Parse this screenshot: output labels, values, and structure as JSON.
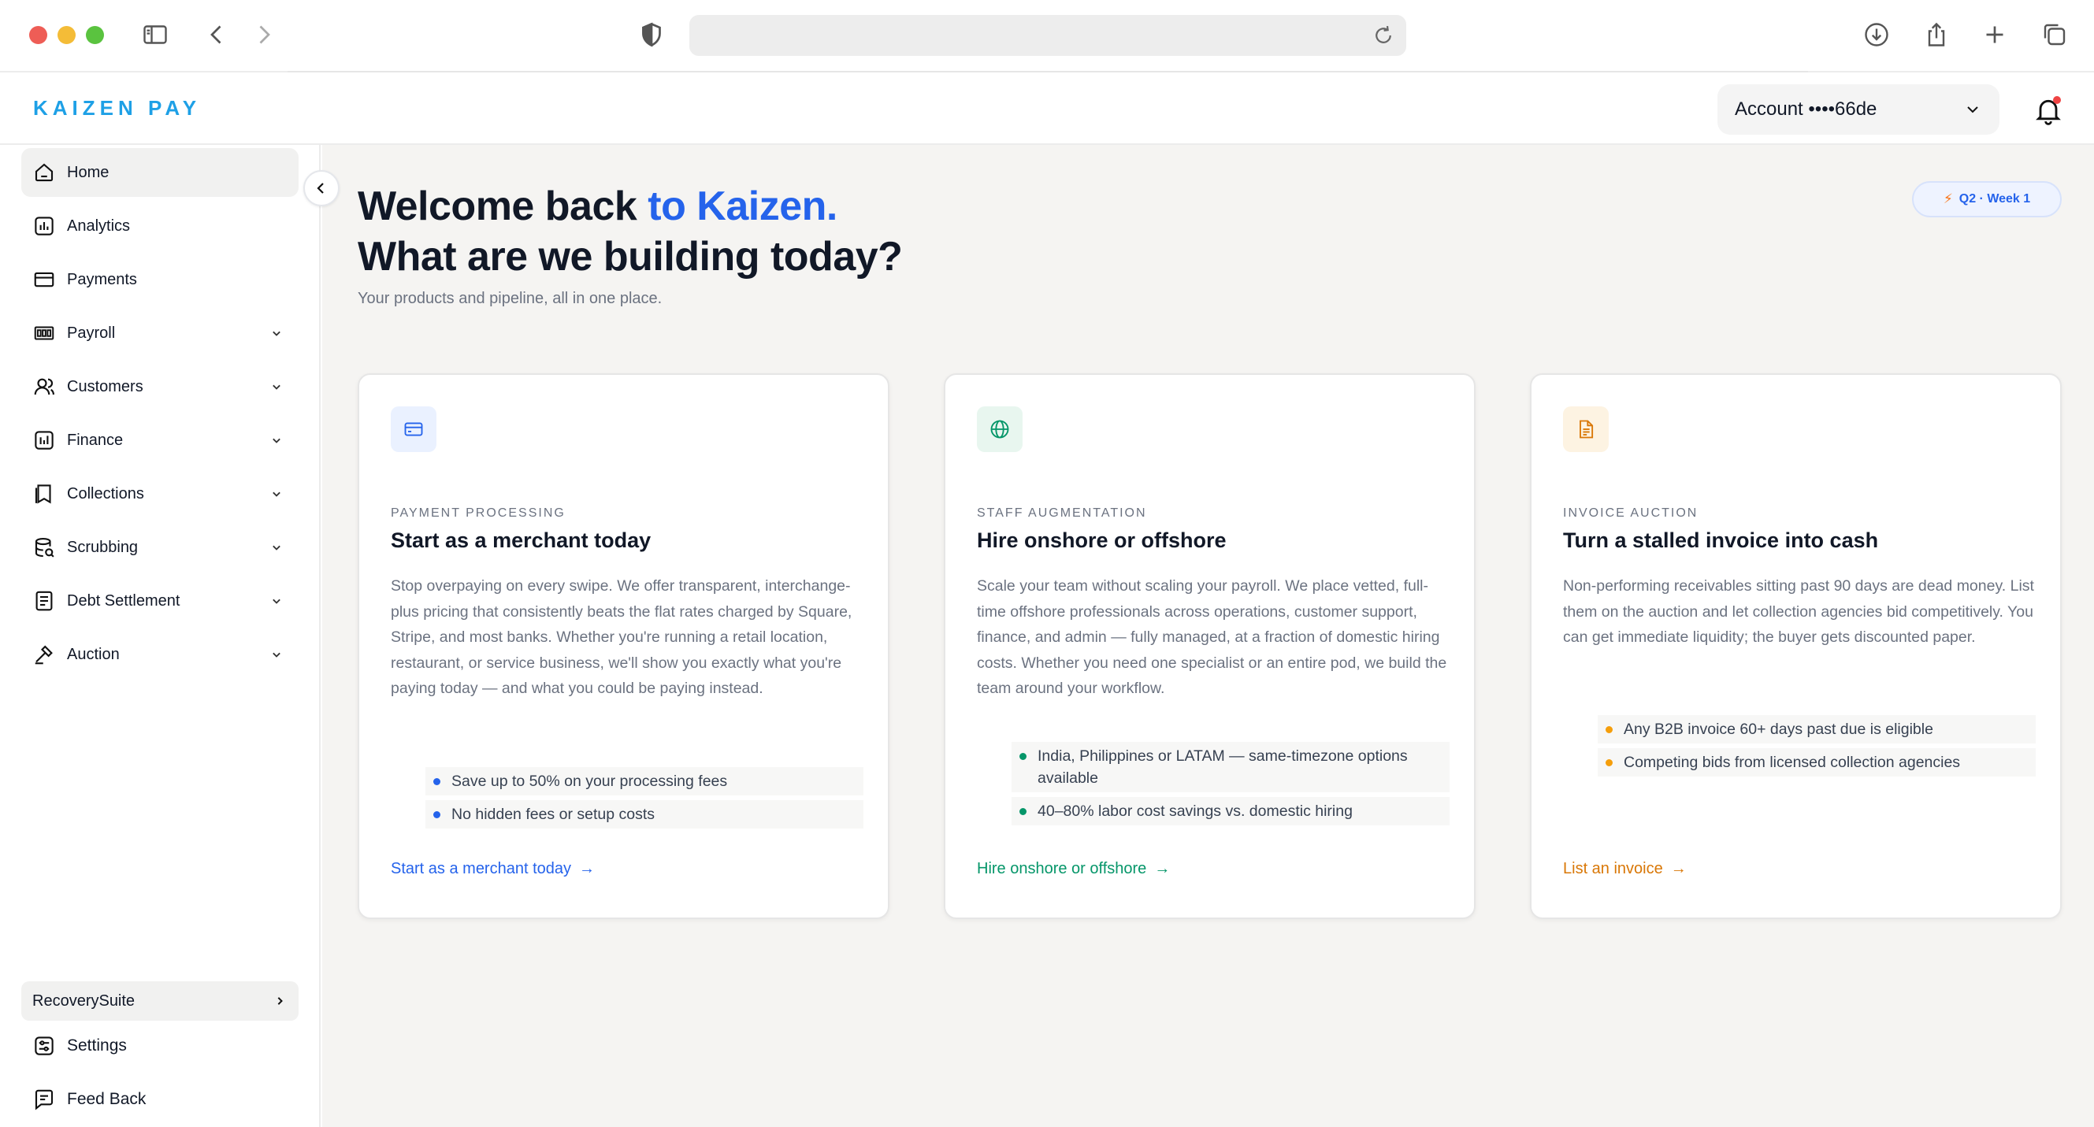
{
  "browser": {
    "url": ""
  },
  "header": {
    "brand": "KAIZEN PAY",
    "account_label": "Account ••••66de"
  },
  "sidebar": {
    "items": [
      {
        "label": "Home",
        "icon": "home-icon",
        "active": true,
        "expandable": false
      },
      {
        "label": "Analytics",
        "icon": "analytics-icon",
        "expandable": false
      },
      {
        "label": "Payments",
        "icon": "credit-card-icon",
        "expandable": false
      },
      {
        "label": "Payroll",
        "icon": "payroll-icon",
        "expandable": true
      },
      {
        "label": "Customers",
        "icon": "users-icon",
        "expandable": true
      },
      {
        "label": "Finance",
        "icon": "finance-icon",
        "expandable": true
      },
      {
        "label": "Collections",
        "icon": "book-icon",
        "expandable": true
      },
      {
        "label": "Scrubbing",
        "icon": "database-icon",
        "expandable": true
      },
      {
        "label": "Debt Settlement",
        "icon": "document-icon",
        "expandable": true
      },
      {
        "label": "Auction",
        "icon": "gavel-icon",
        "expandable": true
      }
    ],
    "recovery_label": "RecoverySuite",
    "settings_label": "Settings",
    "feedback_label": "Feed Back"
  },
  "main": {
    "title_line1_a": "Welcome back ",
    "title_line1_b": "to Kaizen.",
    "title_line2": "What are we building today?",
    "subtitle": "Your products and pipeline, all in one place.",
    "badge": "Q2 · Week 1",
    "cards": [
      {
        "eyebrow": "PAYMENT PROCESSING",
        "title": "Start as a merchant today",
        "body": "Stop overpaying on every swipe. We offer transparent, interchange-plus pricing that consistently beats the flat rates charged by Square, Stripe, and most banks. Whether you're running a retail location, restaurant, or service business, we'll show you exactly what you're paying today — and what you could be paying instead.",
        "bullets": [
          "Save up to 50% on your processing fees",
          "No hidden fees or setup costs"
        ],
        "link": "Start as a merchant today",
        "icon": "credit-card-icon",
        "accent": "#2563eb"
      },
      {
        "eyebrow": "STAFF AUGMENTATION",
        "title": "Hire onshore or offshore",
        "body": "Scale your team without scaling your payroll. We place vetted, full-time offshore professionals across operations, customer support, finance, and admin — fully managed, at a fraction of domestic hiring costs. Whether you need one specialist or an entire pod, we build the team around your workflow.",
        "bullets": [
          "India, Philippines or LATAM — same-timezone options available",
          "40–80% labor cost savings vs. domestic hiring"
        ],
        "link": "Hire onshore or offshore",
        "icon": "globe-icon",
        "accent": "#059669"
      },
      {
        "eyebrow": "INVOICE AUCTION",
        "title": "Turn a stalled invoice into cash",
        "body": "Non-performing receivables sitting past 90 days are dead money. List them on the auction and let collection agencies bid competitively. You can get immediate liquidity; the buyer gets discounted paper.",
        "bullets": [
          "Any B2B invoice 60+ days past due is eligible",
          "Competing bids from licensed collection agencies"
        ],
        "link": "List an invoice",
        "icon": "invoice-icon",
        "accent": "#d97706"
      }
    ]
  }
}
